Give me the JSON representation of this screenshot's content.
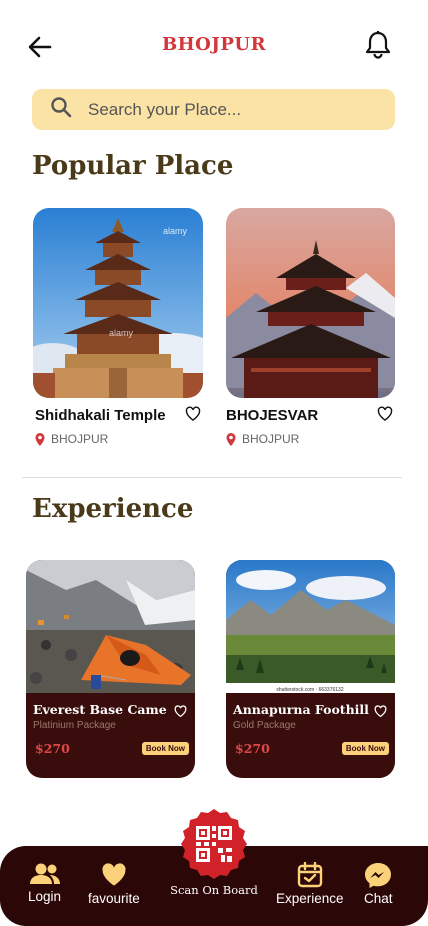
{
  "header": {
    "title": "BHOJPUR"
  },
  "search": {
    "placeholder": "Search your Place..."
  },
  "popular": {
    "title": "Popular Place",
    "items": [
      {
        "name": "Shidhakali Temple",
        "location": "BHOJPUR"
      },
      {
        "name": "BHOJESVAR",
        "location": "BHOJPUR"
      }
    ]
  },
  "experience": {
    "title": "Experience",
    "items": [
      {
        "name": "Everest Base Came",
        "package": "Platinium Package",
        "price": "$270",
        "cta": "Book Now"
      },
      {
        "name": "Annapurna Foothill",
        "package": "Gold Package",
        "price": "$270",
        "cta": "Book Now",
        "credit": "shutterstock.com · 663376132"
      }
    ]
  },
  "nav": {
    "login": "Login",
    "favourite": "favourite",
    "scan": "Scan On Board",
    "experience": "Experience",
    "chat": "Chat"
  },
  "colors": {
    "accent": "#d1373b",
    "dark": "#2c0707",
    "search_bg": "#fbe3a6",
    "icon_yellow": "#fbd27a"
  },
  "images": {
    "watermark": "alamy"
  }
}
